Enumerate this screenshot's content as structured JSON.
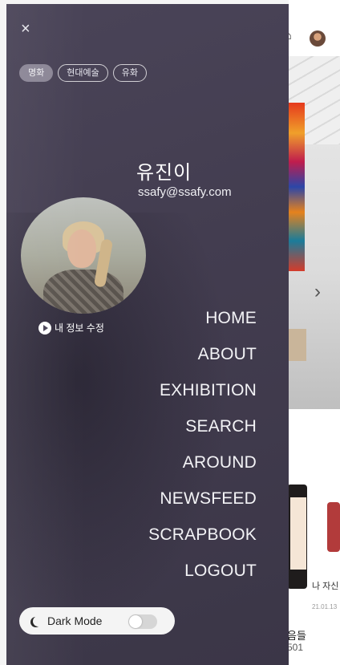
{
  "background": {
    "home_icon": "home-icon",
    "card_title": "나 자신",
    "card_date": "21.01.13",
    "item_title": "음들",
    "item_number": "501"
  },
  "drawer": {
    "close_icon": "close-icon",
    "close_symbol": "×",
    "categories": [
      {
        "label": "명화",
        "active": true
      },
      {
        "label": "현대예술",
        "active": false
      },
      {
        "label": "유화",
        "active": false
      }
    ],
    "profile": {
      "name": "유진이",
      "email": "ssafy@ssafy.com",
      "edit_label": "내 정보 수정"
    },
    "menu": [
      {
        "label": "HOME"
      },
      {
        "label": "ABOUT"
      },
      {
        "label": "EXHIBITION"
      },
      {
        "label": "SEARCH"
      },
      {
        "label": "AROUND"
      },
      {
        "label": "NEWSFEED"
      },
      {
        "label": "SCRAPBOOK"
      },
      {
        "label": "LOGOUT"
      }
    ],
    "dark_mode": {
      "label": "Dark Mode",
      "enabled": false
    }
  },
  "colors": {
    "drawer_bg": "#433d50",
    "chip_active": "#8b8696"
  }
}
